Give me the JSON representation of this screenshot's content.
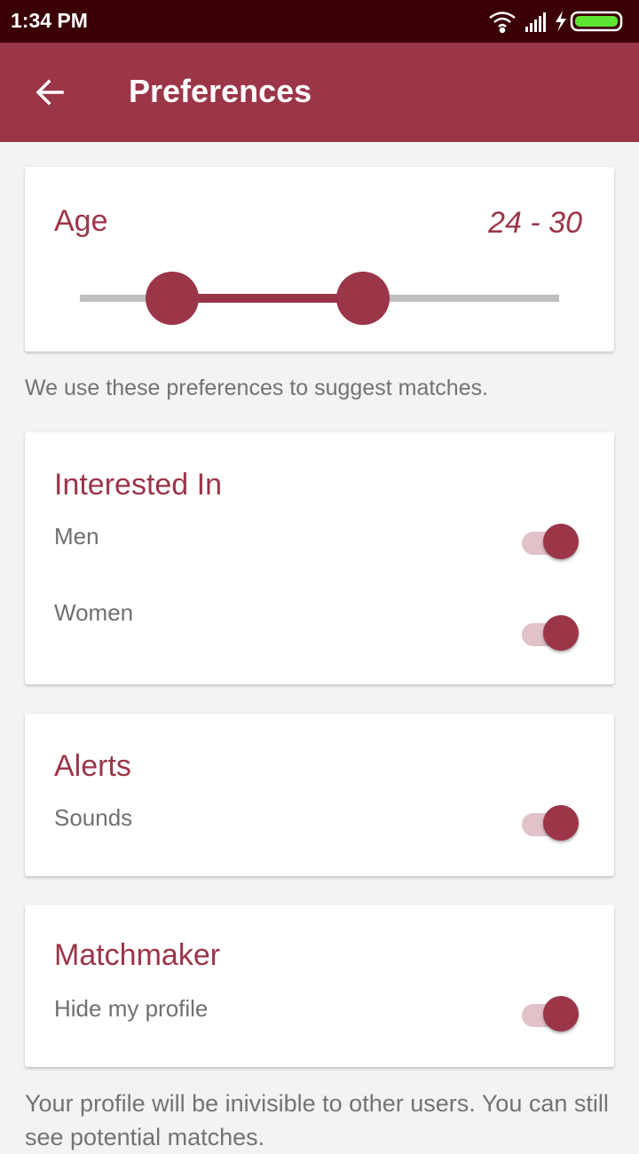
{
  "status_bar": {
    "time": "1:34 PM"
  },
  "app_bar": {
    "title": "Preferences"
  },
  "age": {
    "title": "Age",
    "value_text": "24 - 30",
    "min": 24,
    "max": 30
  },
  "hint_text": "We use these preferences to suggest matches.",
  "interested_in": {
    "title": "Interested In",
    "options": [
      {
        "label": "Men",
        "on": true
      },
      {
        "label": "Women",
        "on": true
      }
    ]
  },
  "alerts": {
    "title": "Alerts",
    "sounds_label": "Sounds",
    "sounds_on": true
  },
  "matchmaker": {
    "title": "Matchmaker",
    "hide_label": "Hide my profile",
    "hide_on": true
  },
  "footer_text": "Your profile will be inivisible to other users. You can still see potential matches.",
  "colors": {
    "accent": "#9b3548",
    "status_bar": "#3a0006",
    "battery": "#5ee632"
  },
  "icons": [
    "arrow-back-icon",
    "wifi-icon",
    "signal-icon",
    "charging-icon",
    "battery-icon"
  ]
}
